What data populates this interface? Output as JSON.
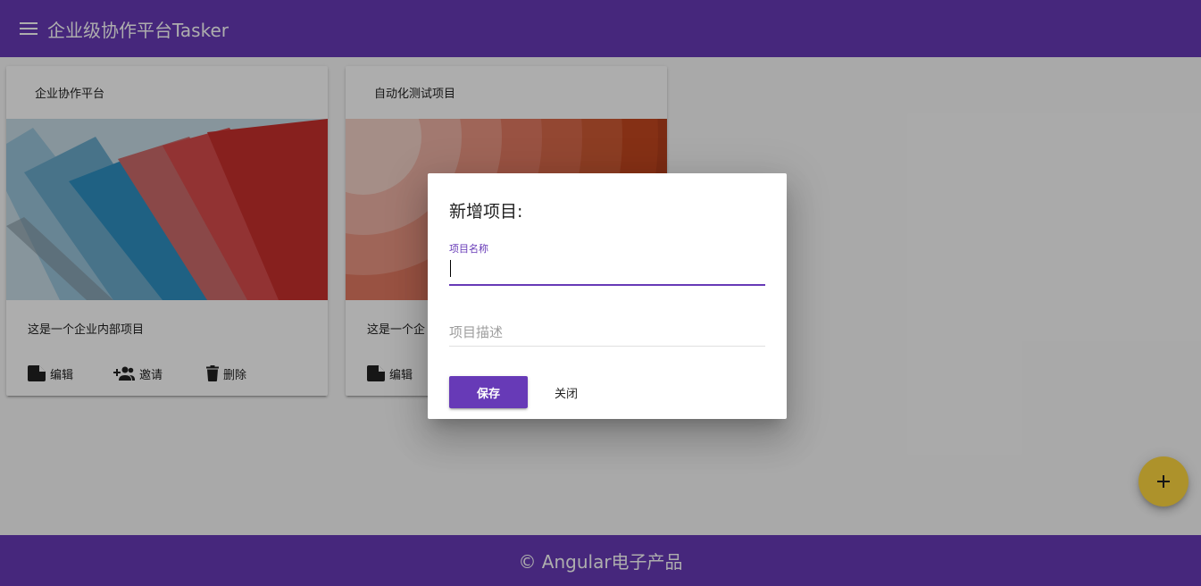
{
  "toolbar": {
    "title": "企业级协作平台Tasker",
    "menu_icon": "menu-icon"
  },
  "projects": [
    {
      "name": "企业协作平台",
      "desc": "这是一个企业内部项目",
      "actions": {
        "edit": "编辑",
        "invite": "邀请",
        "delete": "删除"
      }
    },
    {
      "name": "自动化测试项目",
      "desc": "这是一个企",
      "actions": {
        "edit": "编辑"
      }
    }
  ],
  "dialog": {
    "title": "新增项目:",
    "name_label": "项目名称",
    "name_value": "",
    "desc_placeholder": "项目描述",
    "save_label": "保存",
    "close_label": "关闭"
  },
  "fab": {
    "label": "+"
  },
  "footer": {
    "text": "© Angular电子产品"
  },
  "colors": {
    "primary": "#673ab7",
    "accent": "#ffd740",
    "overlay": "rgba(0,0,0,0.32)"
  }
}
